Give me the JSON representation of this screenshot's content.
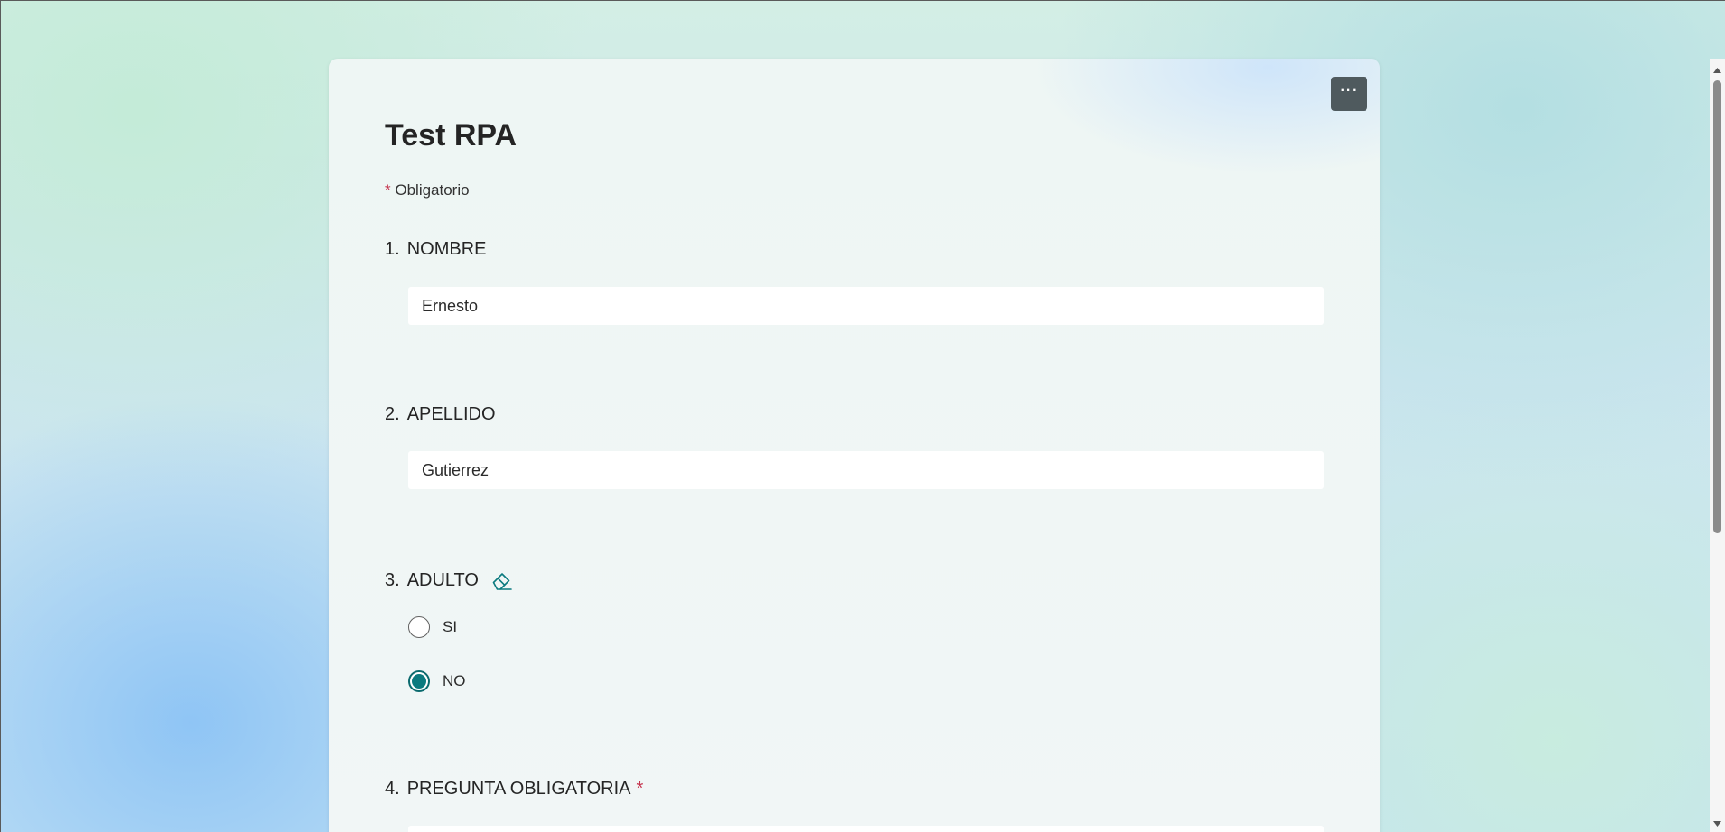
{
  "form": {
    "title": "Test RPA",
    "required_marker": "*",
    "required_note": "Obligatorio",
    "more_button_label": "···",
    "questions": [
      {
        "number": "1.",
        "label": "NOMBRE",
        "type": "text",
        "value": "Ernesto"
      },
      {
        "number": "2.",
        "label": "APELLIDO",
        "type": "text",
        "value": "Gutierrez"
      },
      {
        "number": "3.",
        "label": "ADULTO",
        "type": "radio",
        "clear_icon": "eraser-icon",
        "options": [
          {
            "label": "SI",
            "selected": false
          },
          {
            "label": "NO",
            "selected": true
          }
        ]
      },
      {
        "number": "4.",
        "label": "PREGUNTA OBLIGATORIA",
        "type": "text",
        "required": true,
        "required_marker": "*",
        "value": ""
      }
    ]
  },
  "colors": {
    "accent": "#0b7a7f",
    "required": "#c4314b",
    "more_button_bg": "#4f5a5e"
  }
}
